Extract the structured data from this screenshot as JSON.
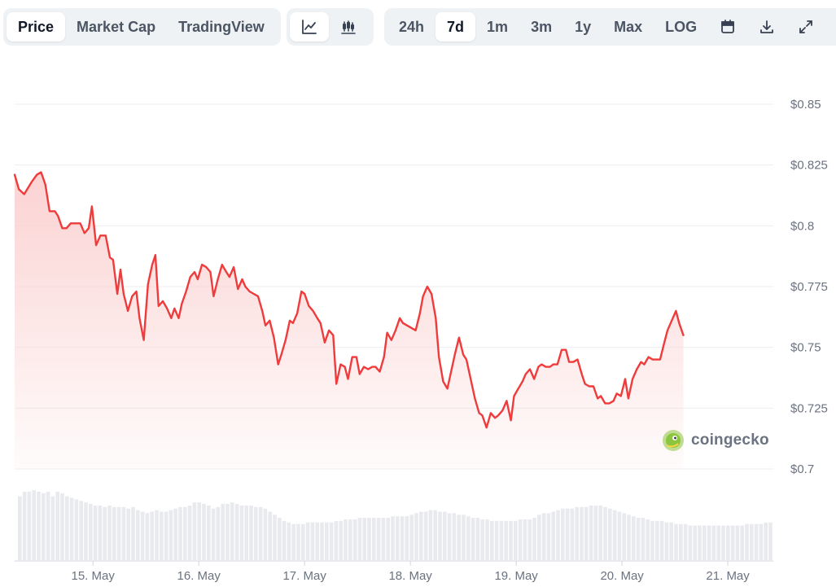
{
  "tabs": [
    {
      "label": "Price",
      "active": true
    },
    {
      "label": "Market Cap",
      "active": false
    },
    {
      "label": "TradingView",
      "active": false
    }
  ],
  "chart_types": [
    {
      "icon": "line-chart-icon",
      "active": true
    },
    {
      "icon": "candlestick-icon",
      "active": false
    }
  ],
  "ranges": [
    {
      "label": "24h",
      "active": false
    },
    {
      "label": "7d",
      "active": true
    },
    {
      "label": "1m",
      "active": false
    },
    {
      "label": "3m",
      "active": false
    },
    {
      "label": "1y",
      "active": false
    },
    {
      "label": "Max",
      "active": false
    },
    {
      "label": "LOG",
      "active": false
    }
  ],
  "tools": [
    {
      "icon": "calendar-icon"
    },
    {
      "icon": "download-icon"
    },
    {
      "icon": "fullscreen-icon"
    }
  ],
  "watermark": {
    "text": "coingecko"
  },
  "colors": {
    "line": "#ef3b3b",
    "area_top": "#fbd0d0",
    "grid": "#eceef1",
    "volume": "#e8eaed"
  },
  "chart_data": {
    "type": "area",
    "title": "",
    "xlabel": "",
    "ylabel": "",
    "ylim": [
      0.7,
      0.85
    ],
    "yticks": [
      0.7,
      0.725,
      0.75,
      0.775,
      0.8,
      0.825,
      0.85
    ],
    "ytick_labels": [
      "$0.7",
      "$0.725",
      "$0.75",
      "$0.775",
      "$0.8",
      "$0.825",
      "$0.85"
    ],
    "xticks": [
      1,
      2,
      3,
      4,
      5,
      6,
      7
    ],
    "xtick_labels": [
      "15. May",
      "16. May",
      "17. May",
      "18. May",
      "19. May",
      "20. May",
      "21. May"
    ],
    "xlim": [
      0.26,
      7.43
    ],
    "grid": true,
    "series": [
      {
        "values": [
          [
            0.26,
            0.821
          ],
          [
            0.3,
            0.815
          ],
          [
            0.35,
            0.813
          ],
          [
            0.42,
            0.818
          ],
          [
            0.47,
            0.821
          ],
          [
            0.51,
            0.822
          ],
          [
            0.55,
            0.817
          ],
          [
            0.59,
            0.806
          ],
          [
            0.64,
            0.806
          ],
          [
            0.67,
            0.804
          ],
          [
            0.71,
            0.799
          ],
          [
            0.75,
            0.799
          ],
          [
            0.79,
            0.801
          ],
          [
            0.84,
            0.801
          ],
          [
            0.88,
            0.801
          ],
          [
            0.92,
            0.797
          ],
          [
            0.96,
            0.799
          ],
          [
            0.99,
            0.808
          ],
          [
            1.03,
            0.792
          ],
          [
            1.07,
            0.796
          ],
          [
            1.12,
            0.796
          ],
          [
            1.16,
            0.787
          ],
          [
            1.19,
            0.786
          ],
          [
            1.23,
            0.772
          ],
          [
            1.26,
            0.782
          ],
          [
            1.29,
            0.772
          ],
          [
            1.33,
            0.765
          ],
          [
            1.37,
            0.771
          ],
          [
            1.41,
            0.773
          ],
          [
            1.44,
            0.762
          ],
          [
            1.48,
            0.753
          ],
          [
            1.52,
            0.776
          ],
          [
            1.56,
            0.784
          ],
          [
            1.59,
            0.788
          ],
          [
            1.62,
            0.767
          ],
          [
            1.66,
            0.769
          ],
          [
            1.7,
            0.766
          ],
          [
            1.74,
            0.762
          ],
          [
            1.77,
            0.766
          ],
          [
            1.81,
            0.762
          ],
          [
            1.84,
            0.768
          ],
          [
            1.88,
            0.773
          ],
          [
            1.92,
            0.779
          ],
          [
            1.96,
            0.781
          ],
          [
            1.99,
            0.778
          ],
          [
            2.03,
            0.784
          ],
          [
            2.07,
            0.783
          ],
          [
            2.11,
            0.781
          ],
          [
            2.14,
            0.771
          ],
          [
            2.18,
            0.778
          ],
          [
            2.22,
            0.784
          ],
          [
            2.26,
            0.781
          ],
          [
            2.29,
            0.779
          ],
          [
            2.33,
            0.783
          ],
          [
            2.37,
            0.774
          ],
          [
            2.41,
            0.778
          ],
          [
            2.44,
            0.775
          ],
          [
            2.48,
            0.773
          ],
          [
            2.52,
            0.772
          ],
          [
            2.56,
            0.771
          ],
          [
            2.6,
            0.765
          ],
          [
            2.63,
            0.759
          ],
          [
            2.67,
            0.761
          ],
          [
            2.71,
            0.754
          ],
          [
            2.75,
            0.743
          ],
          [
            2.78,
            0.747
          ],
          [
            2.82,
            0.753
          ],
          [
            2.86,
            0.761
          ],
          [
            2.89,
            0.76
          ],
          [
            2.93,
            0.764
          ],
          [
            2.97,
            0.773
          ],
          [
            3.0,
            0.772
          ],
          [
            3.04,
            0.767
          ],
          [
            3.08,
            0.765
          ],
          [
            3.12,
            0.762
          ],
          [
            3.15,
            0.76
          ],
          [
            3.19,
            0.752
          ],
          [
            3.23,
            0.757
          ],
          [
            3.27,
            0.755
          ],
          [
            3.3,
            0.735
          ],
          [
            3.34,
            0.743
          ],
          [
            3.38,
            0.742
          ],
          [
            3.41,
            0.737
          ],
          [
            3.45,
            0.746
          ],
          [
            3.49,
            0.746
          ],
          [
            3.52,
            0.739
          ],
          [
            3.56,
            0.742
          ],
          [
            3.6,
            0.741
          ],
          [
            3.64,
            0.742
          ],
          [
            3.67,
            0.742
          ],
          [
            3.71,
            0.74
          ],
          [
            3.75,
            0.746
          ],
          [
            3.78,
            0.756
          ],
          [
            3.82,
            0.753
          ],
          [
            3.86,
            0.757
          ],
          [
            3.9,
            0.762
          ],
          [
            3.93,
            0.76
          ],
          [
            3.97,
            0.759
          ],
          [
            4.01,
            0.758
          ],
          [
            4.05,
            0.757
          ],
          [
            4.09,
            0.764
          ],
          [
            4.12,
            0.771
          ],
          [
            4.16,
            0.775
          ],
          [
            4.2,
            0.772
          ],
          [
            4.24,
            0.762
          ],
          [
            4.27,
            0.746
          ],
          [
            4.31,
            0.736
          ],
          [
            4.35,
            0.733
          ],
          [
            4.39,
            0.741
          ],
          [
            4.42,
            0.747
          ],
          [
            4.46,
            0.754
          ],
          [
            4.5,
            0.747
          ],
          [
            4.53,
            0.745
          ],
          [
            4.57,
            0.737
          ],
          [
            4.61,
            0.729
          ],
          [
            4.65,
            0.723
          ],
          [
            4.68,
            0.722
          ],
          [
            4.72,
            0.717
          ],
          [
            4.76,
            0.723
          ],
          [
            4.8,
            0.721
          ],
          [
            4.83,
            0.722
          ],
          [
            4.87,
            0.724
          ],
          [
            4.91,
            0.728
          ],
          [
            4.95,
            0.72
          ],
          [
            4.98,
            0.73
          ],
          [
            5.02,
            0.733
          ],
          [
            5.06,
            0.736
          ],
          [
            5.09,
            0.739
          ],
          [
            5.13,
            0.741
          ],
          [
            5.17,
            0.737
          ],
          [
            5.21,
            0.742
          ],
          [
            5.24,
            0.743
          ],
          [
            5.28,
            0.742
          ],
          [
            5.32,
            0.742
          ],
          [
            5.35,
            0.743
          ],
          [
            5.39,
            0.743
          ],
          [
            5.43,
            0.749
          ],
          [
            5.47,
            0.749
          ],
          [
            5.5,
            0.744
          ],
          [
            5.54,
            0.744
          ],
          [
            5.58,
            0.745
          ],
          [
            5.62,
            0.739
          ],
          [
            5.65,
            0.735
          ],
          [
            5.69,
            0.734
          ],
          [
            5.73,
            0.734
          ],
          [
            5.77,
            0.729
          ],
          [
            5.8,
            0.73
          ],
          [
            5.84,
            0.727
          ],
          [
            5.88,
            0.727
          ],
          [
            5.92,
            0.728
          ],
          [
            5.95,
            0.731
          ],
          [
            5.99,
            0.73
          ],
          [
            6.03,
            0.737
          ],
          [
            6.06,
            0.729
          ],
          [
            6.1,
            0.737
          ],
          [
            6.14,
            0.741
          ],
          [
            6.18,
            0.744
          ],
          [
            6.21,
            0.743
          ],
          [
            6.25,
            0.746
          ],
          [
            6.29,
            0.745
          ],
          [
            6.32,
            0.745
          ],
          [
            6.36,
            0.745
          ],
          [
            6.4,
            0.752
          ],
          [
            6.43,
            0.757
          ],
          [
            6.47,
            0.761
          ],
          [
            6.51,
            0.765
          ],
          [
            6.54,
            0.76
          ],
          [
            6.58,
            0.755
          ]
        ]
      }
    ],
    "volume": [
      0.42,
      0.45,
      0.45,
      0.46,
      0.45,
      0.44,
      0.45,
      0.42,
      0.45,
      0.44,
      0.42,
      0.41,
      0.4,
      0.39,
      0.38,
      0.37,
      0.36,
      0.36,
      0.35,
      0.36,
      0.35,
      0.35,
      0.35,
      0.34,
      0.35,
      0.33,
      0.32,
      0.31,
      0.32,
      0.33,
      0.32,
      0.32,
      0.33,
      0.34,
      0.35,
      0.35,
      0.36,
      0.38,
      0.38,
      0.37,
      0.36,
      0.34,
      0.35,
      0.37,
      0.37,
      0.38,
      0.37,
      0.36,
      0.36,
      0.36,
      0.35,
      0.35,
      0.34,
      0.32,
      0.3,
      0.28,
      0.26,
      0.25,
      0.24,
      0.24,
      0.24,
      0.25,
      0.25,
      0.25,
      0.25,
      0.25,
      0.25,
      0.26,
      0.26,
      0.27,
      0.27,
      0.27,
      0.28,
      0.28,
      0.28,
      0.28,
      0.28,
      0.28,
      0.28,
      0.29,
      0.29,
      0.29,
      0.29,
      0.3,
      0.31,
      0.32,
      0.32,
      0.33,
      0.33,
      0.32,
      0.32,
      0.31,
      0.31,
      0.3,
      0.3,
      0.29,
      0.28,
      0.28,
      0.27,
      0.27,
      0.26,
      0.26,
      0.26,
      0.26,
      0.26,
      0.26,
      0.27,
      0.27,
      0.27,
      0.28,
      0.3,
      0.31,
      0.31,
      0.32,
      0.33,
      0.34,
      0.34,
      0.34,
      0.35,
      0.35,
      0.35,
      0.36,
      0.36,
      0.36,
      0.35,
      0.34,
      0.33,
      0.32,
      0.31,
      0.3,
      0.29,
      0.28,
      0.28,
      0.27,
      0.26,
      0.26,
      0.26,
      0.25,
      0.25,
      0.24,
      0.24,
      0.24,
      0.23,
      0.23,
      0.23,
      0.23,
      0.23,
      0.23,
      0.23,
      0.23,
      0.23,
      0.23,
      0.23,
      0.23,
      0.24,
      0.24,
      0.24,
      0.24,
      0.25,
      0.25
    ]
  }
}
